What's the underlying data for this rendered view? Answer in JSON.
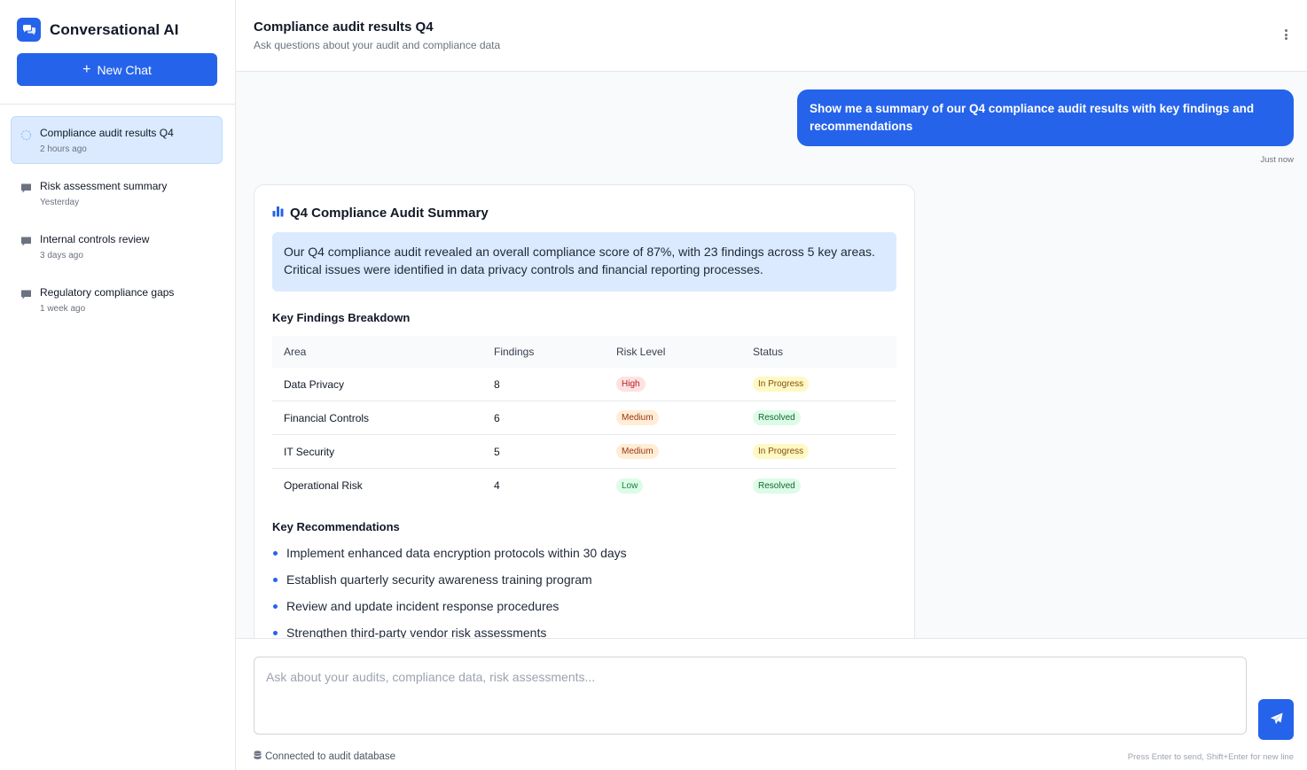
{
  "app": {
    "title": "Conversational AI",
    "accent_color": "#2563eb"
  },
  "sidebar": {
    "new_chat_label": "New Chat",
    "conversations": [
      {
        "title": "Compliance audit results Q4",
        "time": "2 hours ago",
        "icon": "loading-circle-icon",
        "active": true
      },
      {
        "title": "Risk assessment summary",
        "time": "Yesterday",
        "icon": "chat-bubble-icon",
        "active": false
      },
      {
        "title": "Internal controls review",
        "time": "3 days ago",
        "icon": "chat-bubble-icon",
        "active": false
      },
      {
        "title": "Regulatory compliance gaps",
        "time": "1 week ago",
        "icon": "chat-bubble-icon",
        "active": false
      }
    ]
  },
  "header": {
    "title": "Compliance audit results Q4",
    "subtitle": "Ask questions about your audit and compliance data"
  },
  "messages": {
    "user": {
      "text": "Show me a summary of our Q4 compliance audit results with key findings and recommendations",
      "time": "Just now"
    },
    "assistant": {
      "title": "Q4 Compliance Audit Summary",
      "summary": "Our Q4 compliance audit revealed an overall compliance score of 87%, with 23 findings across 5 key areas. Critical issues were identified in data privacy controls and financial reporting processes.",
      "findings_title": "Key Findings Breakdown",
      "table": {
        "headers": [
          "Area",
          "Findings",
          "Risk Level",
          "Status"
        ],
        "rows": [
          {
            "area": "Data Privacy",
            "findings": "8",
            "risk": "High",
            "status": "In Progress"
          },
          {
            "area": "Financial Controls",
            "findings": "6",
            "risk": "Medium",
            "status": "Resolved"
          },
          {
            "area": "IT Security",
            "findings": "5",
            "risk": "Medium",
            "status": "In Progress"
          },
          {
            "area": "Operational Risk",
            "findings": "4",
            "risk": "Low",
            "status": "Resolved"
          }
        ]
      },
      "recommendations_title": "Key Recommendations",
      "recommendations": [
        "Implement enhanced data encryption protocols within 30 days",
        "Establish quarterly security awareness training program",
        "Review and update incident response procedures",
        "Strengthen third-party vendor risk assessments"
      ]
    }
  },
  "composer": {
    "placeholder": "Ask about your audits, compliance data, risk assessments...",
    "connection_status": "Connected to audit database",
    "hint": "Press Enter to send, Shift+Enter for new line"
  }
}
